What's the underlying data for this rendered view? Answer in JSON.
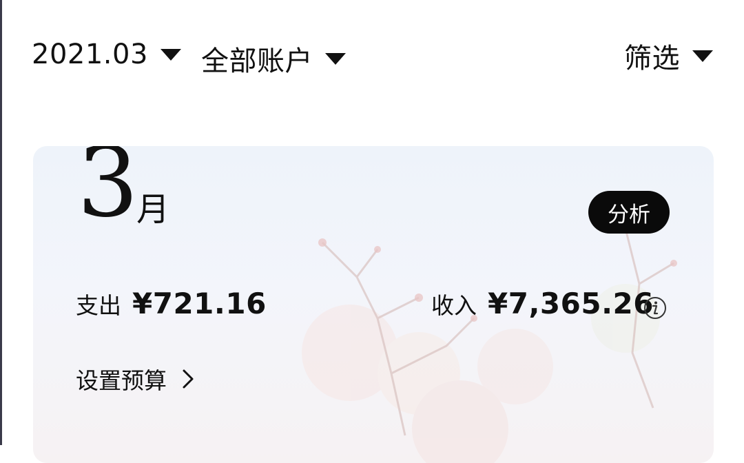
{
  "header": {
    "month_selector": "2021.03",
    "account_selector": "全部账户",
    "filter_label": "筛选"
  },
  "summary": {
    "month_number": "3",
    "month_suffix": "月",
    "analysis_button": "分析",
    "expense_label": "支出",
    "expense_amount": "¥721.16",
    "income_label": "收入",
    "income_amount": "¥7,365.26",
    "budget_link": "设置预算"
  },
  "icons": [
    "caret-down-icon",
    "info-icon",
    "chevron-right-icon"
  ],
  "colors": {
    "text": "#111111",
    "button_bg": "#0a0a0a",
    "button_text": "#ffffff",
    "card_bg": "#f1f4fa"
  }
}
